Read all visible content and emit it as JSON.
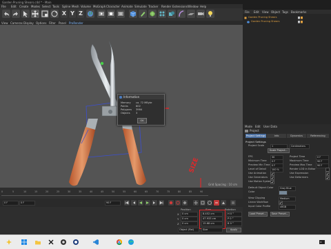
{
  "app": {
    "title": "Garden Pruning Shears.c4d * - Main",
    "menu": [
      "File",
      "Edit",
      "Create",
      "Modes",
      "Select",
      "Tools",
      "Spline",
      "Mesh",
      "Volume",
      "MoGraph",
      "Character",
      "Animate",
      "Simulate",
      "Tracker",
      "Render",
      "Extensions",
      "Window",
      "Help"
    ]
  },
  "toolbar": {
    "axis_labels": [
      "X",
      "Y",
      "Z"
    ],
    "icons": [
      "undo-icon",
      "redo-icon",
      "live-select-icon",
      "move-icon",
      "scale-icon",
      "rotate-icon",
      "x-axis-icon",
      "y-axis-icon",
      "z-axis-icon",
      "world-icon",
      "render-region-icon",
      "render-view-icon",
      "render-settings-icon",
      "cube-icon",
      "pen-icon",
      "subdivision-icon",
      "array-icon",
      "boole-icon",
      "deformer-icon",
      "floor-icon",
      "camera-icon",
      "light-icon"
    ]
  },
  "viewport": {
    "menu": [
      "View",
      "Cameras",
      "Display",
      "Options",
      "Filter",
      "Panel",
      "ProRender"
    ],
    "grid_spacing": "Grid Spacing : 10 cm"
  },
  "info_dialog": {
    "title": "Information",
    "rows": [
      {
        "label": "Memory",
        "value": "ca. 72 MByte"
      },
      {
        "label": "Points",
        "value": "802"
      },
      {
        "label": "Polygons",
        "value": "3984"
      },
      {
        "label": "Objects",
        "value": "3"
      }
    ],
    "ok": "OK"
  },
  "timeline": {
    "ticks": [
      "0",
      "5",
      "10",
      "15",
      "20",
      "25",
      "30",
      "35",
      "40",
      "45",
      "50",
      "55",
      "60",
      "65",
      "70",
      "75",
      "80",
      "85",
      "90"
    ],
    "start": "0 F",
    "end": "90 F",
    "current": "0 F"
  },
  "coordinates": {
    "headers": [
      "Position",
      "Size",
      "Rotation"
    ],
    "axes": [
      "X",
      "Y",
      "Z"
    ],
    "position": [
      "0 cm",
      "0 cm",
      "0 cm"
    ],
    "size": [
      "8.452 cm",
      "47.933 cm",
      "15.68 cm"
    ],
    "rotation": [
      "H 0 °",
      "P 0 °",
      "B 0 °"
    ],
    "mode": "Object (Rel)",
    "size_mode": "Size",
    "apply": "Apply"
  },
  "annotation": {
    "text": "SIZE",
    "color": "#e0282a"
  },
  "object_manager": {
    "menu": [
      "File",
      "Edit",
      "View",
      "Object",
      "Tags",
      "Bookmarks"
    ],
    "objects": [
      "Garden Pruning Shears",
      "Garden Pruning Shears"
    ]
  },
  "attribute_manager": {
    "menu": [
      "Mode",
      "Edit",
      "User Data"
    ],
    "object_label": "Project",
    "tabs": [
      "Project Settings",
      "Info",
      "Dynamics",
      "Referencing"
    ],
    "section_title": "Project Settings",
    "rows_left": [
      {
        "label": "Project Scale",
        "value": "1"
      },
      {
        "label": "FPS",
        "value": "30"
      },
      {
        "label": "Minimum Time",
        "value": "0 F"
      },
      {
        "label": "Preview Min Time",
        "value": "0 F"
      },
      {
        "label": "Level of Detail",
        "value": "100 %"
      }
    ],
    "rows_right": [
      {
        "label": "Centimeters",
        "value": ""
      },
      {
        "label": "Project Time",
        "value": "0 F"
      },
      {
        "label": "Maximum Time",
        "value": "90 F"
      },
      {
        "label": "Preview Max Time",
        "value": "90 F"
      },
      {
        "label": "Render LOD in Editor",
        "value": ""
      }
    ],
    "scale_button": "Scale Project...",
    "checks": [
      "Use Animation",
      "Use Generators",
      "Use Motion System"
    ],
    "checks_right": [
      "Use Expression",
      "Use Deformers"
    ],
    "lower_rows": [
      {
        "label": "Default Object Color",
        "value": "Gray Blue"
      },
      {
        "label": "Color",
        "value": ""
      },
      {
        "label": "View Clipping",
        "value": "Medium"
      },
      {
        "label": "Linear Workflow",
        "value": ""
      },
      {
        "label": "Input Color Profile",
        "value": "sRGB"
      }
    ],
    "buttons": [
      "Load Preset...",
      "Save Preset..."
    ]
  },
  "taskbar": {
    "icons": [
      "start-icon",
      "search-icon",
      "file-explorer-icon",
      "x-app-icon",
      "obs-icon",
      "cinema4d-icon",
      "vscode-icon",
      "chrome-icon",
      "edge-icon",
      "cmd-icon"
    ]
  }
}
